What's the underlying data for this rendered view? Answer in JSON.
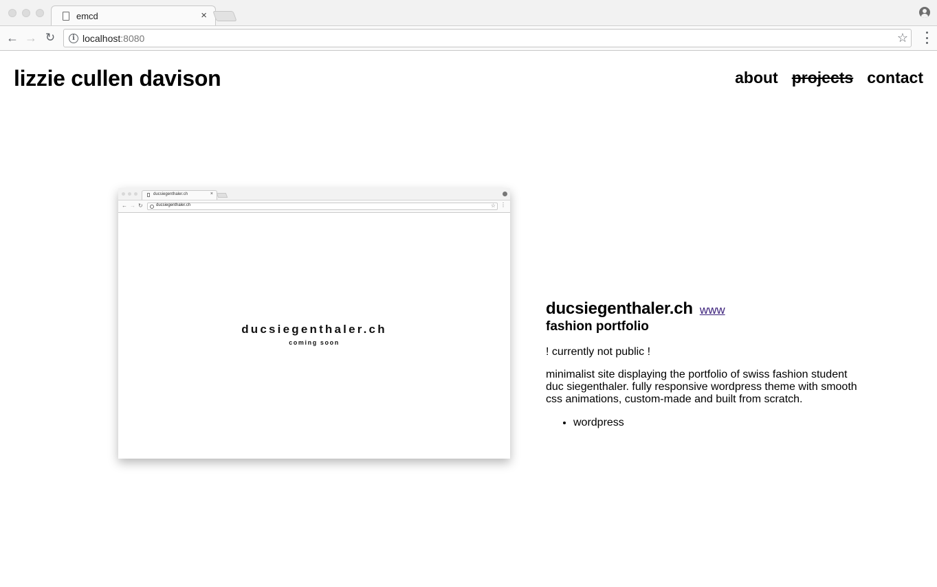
{
  "browser": {
    "tab_title": "emcd",
    "tab_close": "×",
    "url_host": "localhost",
    "url_port": ":8080",
    "icons": [
      "page-icon",
      "close-icon",
      "new-tab-icon",
      "profile-icon",
      "back-icon",
      "forward-icon",
      "reload-icon",
      "info-icon",
      "star-icon",
      "menu-icon"
    ]
  },
  "site": {
    "title": "lizzie cullen davison",
    "nav": {
      "about": "about",
      "projects": "projects",
      "contact": "contact"
    }
  },
  "project": {
    "preview": {
      "tab_title": "ducsiegenthaler.ch",
      "url": "ducsiegenthaler.ch",
      "site_name": "ducsiegenthaler.ch",
      "site_sub": "coming soon"
    },
    "title": "ducsiegenthaler.ch",
    "link_label": "www",
    "subtitle": "fashion portfolio",
    "note": "! currently not public !",
    "description": "minimalist site displaying the portfolio of swiss fashion student duc siegenthaler. fully responsive wordpress theme with smooth css animations, custom-made and built from scratch.",
    "tags": [
      "wordpress"
    ]
  },
  "colors": {
    "link": "#3a1f7a",
    "chrome_bg": "#f2f2f2",
    "text": "#000000"
  }
}
